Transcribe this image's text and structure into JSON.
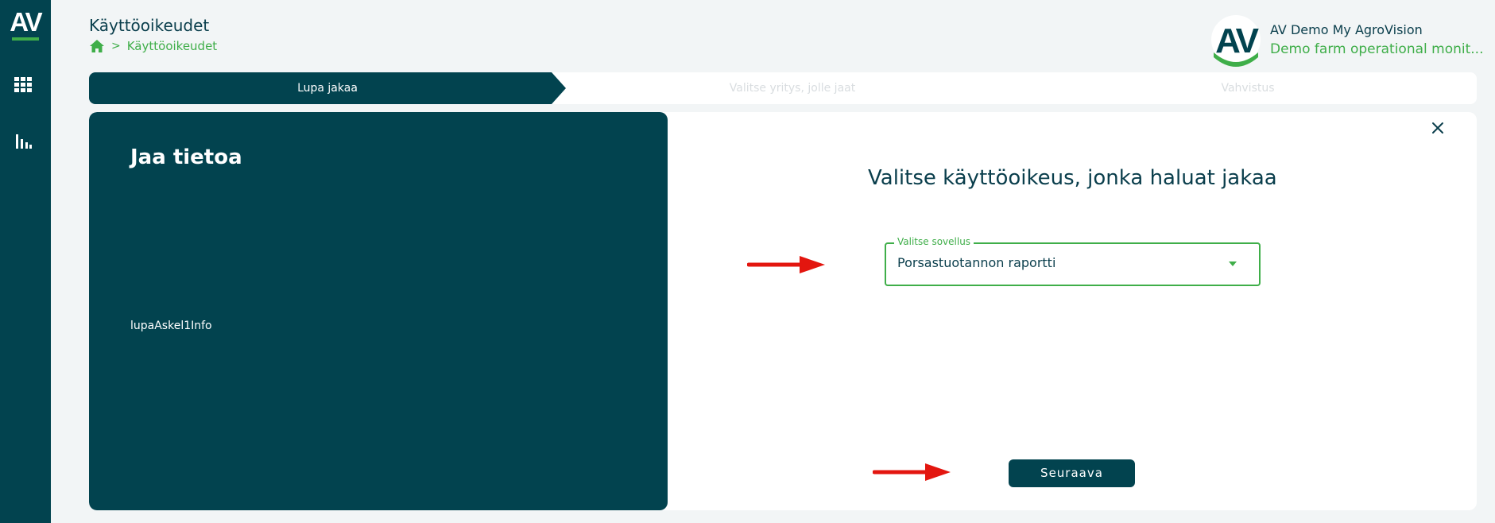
{
  "sidebar": {
    "logo_text": "AV",
    "icons": [
      "apps-grid-icon",
      "bar-chart-icon"
    ]
  },
  "header": {
    "title": "Käyttöoikeudet",
    "breadcrumb": {
      "home_icon": "home-icon",
      "separator": ">",
      "current": "Käyttöoikeudet"
    }
  },
  "account": {
    "logo_text": "AV",
    "name": "AV Demo My AgroVision",
    "subtitle": "Demo farm operational monit..."
  },
  "stepper": {
    "steps": [
      {
        "label": "Lupa jakaa",
        "active": true
      },
      {
        "label": "Valitse yritys, jolle jaat",
        "active": false
      },
      {
        "label": "Vahvistus",
        "active": false
      }
    ]
  },
  "left_panel": {
    "title": "Jaa tietoa",
    "info": "lupaAskel1Info"
  },
  "main": {
    "title": "Valitse käyttöoikeus, jonka haluat jakaa",
    "select": {
      "label": "Valitse sovellus",
      "value": "Porsastuotannon raportti"
    },
    "next_button": "Seuraava"
  },
  "colors": {
    "primary": "#02434f",
    "accent": "#3fae49",
    "background": "#f2f5f6",
    "annotation_arrow": "#e3160f"
  }
}
